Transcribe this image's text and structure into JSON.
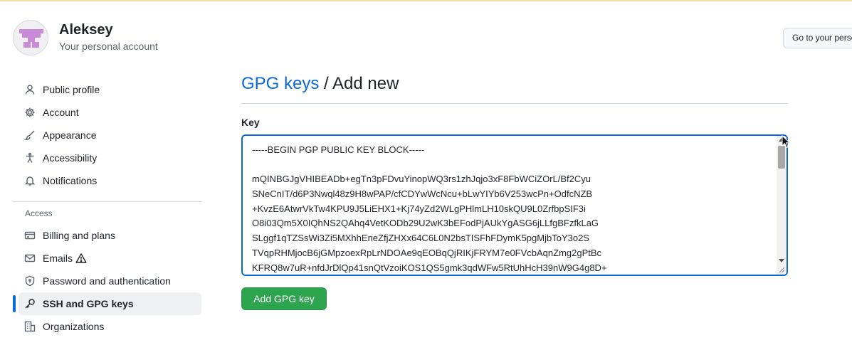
{
  "header": {
    "username": "Aleksey",
    "account_label": "Your personal account",
    "go_profile_button": "Go to your personal profile"
  },
  "sidebar": {
    "items": [
      {
        "label": "Public profile",
        "icon": "person-icon"
      },
      {
        "label": "Account",
        "icon": "gear-icon"
      },
      {
        "label": "Appearance",
        "icon": "paintbrush-icon"
      },
      {
        "label": "Accessibility",
        "icon": "accessibility-icon"
      },
      {
        "label": "Notifications",
        "icon": "bell-icon"
      }
    ],
    "access_section_title": "Access",
    "access_items": [
      {
        "label": "Billing and plans",
        "icon": "credit-card-icon"
      },
      {
        "label": "Emails",
        "icon": "mail-icon",
        "badge_icon": "alert-icon"
      },
      {
        "label": "Password and authentication",
        "icon": "shield-lock-icon"
      },
      {
        "label": "SSH and GPG keys",
        "icon": "key-icon",
        "active": true
      },
      {
        "label": "Organizations",
        "icon": "organization-icon"
      }
    ]
  },
  "main": {
    "breadcrumb_link": "GPG keys",
    "breadcrumb_rest": " / Add new",
    "key_label": "Key",
    "key_lines": [
      "-----BEGIN PGP PUBLIC KEY BLOCK-----",
      "",
      "mQINBGJgVHIBEADb+egTn3pFDvuYinopWQ3rs1zhJqjo3xF8FbWCiZOrL/Bf2Cyu",
      "SNeCnIT/d6P3Nwql48z9H8wPAP/cfCDYwWcNcu+bLwYIYb6V253wcPn+OdfcNZB",
      "+KvzE6AtwrVkTw4KPU9J5LiEHX1+Kj74yZd2WLgPHlmLH10skQU9L0ZrfbpSIF3i",
      "O8i03Qm5X0IQhNS2QAhq4VetKODb29U2wK3bEFodPjAUkYgASG6jLLfgBFzfkLaG",
      "SLggf1qTZSsWi3Zi5MXhhEneZfjZHXx64C6L0N2bsTISFhFDymK5pgMjbToY3o2S",
      "TVqpRHMjocB6jGMpzoexRpLrNDOAe9qEOBqQjRIKjFRYM7e0FVcbAqnZmg2gPtBc",
      "KFRQ8w7uR+nfdJrDlQp41snQtVzoiKOS1QS5gmk3qdWFw5RtUhHcH39nW9G4g8D+"
    ],
    "submit_button": "Add GPG key"
  },
  "colors": {
    "accent": "#0969da",
    "button_green": "#2da44e",
    "active_bar": "#0969da"
  }
}
